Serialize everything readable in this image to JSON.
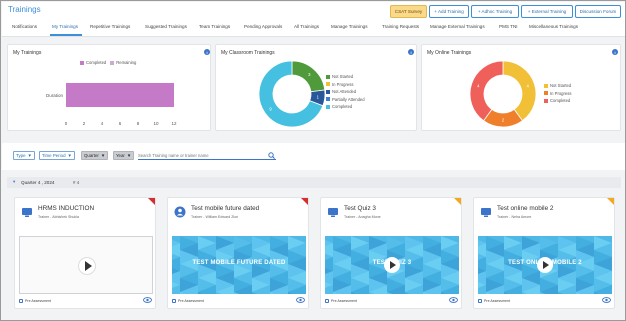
{
  "header": {
    "title": "Trainings",
    "buttons": [
      "CSAT Survey",
      "+ Add Training",
      "+ Adhoc Training",
      "+ External Training",
      "Discussion Forum"
    ]
  },
  "tabs": [
    "Notifications",
    "My Trainings",
    "Repetitive Trainings",
    "Suggested Trainings",
    "Team Trainings",
    "Pending Approvals",
    "All Trainings",
    "Manage Trainings",
    "Training Requests",
    "Manage External Trainings",
    "PMS TNI",
    "Miscellaneous Trainings"
  ],
  "active_tab": "My Trainings",
  "my_trainings": {
    "title": "My Trainings",
    "legend": [
      "Completed",
      "Remaining"
    ],
    "category": "Duration",
    "ticks": [
      "0",
      "2",
      "4",
      "6",
      "8",
      "10",
      "12"
    ],
    "chart_data": {
      "type": "bar",
      "orientation": "horizontal",
      "categories": [
        "Duration"
      ],
      "series": [
        {
          "name": "Completed",
          "values": [
            12
          ]
        },
        {
          "name": "Remaining",
          "values": [
            0
          ]
        }
      ],
      "xlim": [
        0,
        12
      ],
      "colors": {
        "Completed": "#c57ac7",
        "Remaining": "#d0a8d6"
      }
    }
  },
  "classroom": {
    "title": "My Classroom Trainings",
    "legend": [
      {
        "label": "Not Started",
        "color": "#4f9a3a"
      },
      {
        "label": "In Progress",
        "color": "#f2c037"
      },
      {
        "label": "Not Attended",
        "color": "#28579a"
      },
      {
        "label": "Partially Attended",
        "color": "#3a7fd5"
      },
      {
        "label": "Completed",
        "color": "#45c0e0"
      }
    ],
    "chart_data": {
      "type": "pie",
      "labels": [
        "Not Started",
        "In Progress",
        "Not Attended",
        "Partially Attended",
        "Completed"
      ],
      "values": [
        3,
        0,
        1,
        0,
        9
      ]
    }
  },
  "online": {
    "title": "My Online Trainings",
    "legend": [
      {
        "label": "Not Started",
        "color": "#f2c037"
      },
      {
        "label": "In Progress",
        "color": "#f07f2c"
      },
      {
        "label": "Completed",
        "color": "#f0605a"
      }
    ],
    "chart_data": {
      "type": "pie",
      "labels": [
        "Not Started",
        "In Progress",
        "Completed"
      ],
      "values": [
        4,
        2,
        4
      ]
    }
  },
  "filters": {
    "type": "Type",
    "time_period": "Time Period",
    "quarter": "Quarter",
    "year": "Year",
    "search_placeholder": "Search Training name or trainer name"
  },
  "quarter_group": {
    "label": "Quarter 4 , 2024",
    "count": "4"
  },
  "courses": [
    {
      "title": "HRMS INDUCTION",
      "trainer": "Trainer - Abhishek Shukla",
      "footer": "Pre Assessment",
      "thumb": "",
      "corner": "red"
    },
    {
      "title": "Test mobile future dated",
      "trainer": "Trainer - William Edward Zion",
      "footer": "Pre Assessment",
      "thumb": "TEST MOBILE FUTURE DATED",
      "corner": "red"
    },
    {
      "title": "Test Quiz 3",
      "trainer": "Trainer - Anagha Mone",
      "footer": "Pre Assessment",
      "thumb": "TEST QUIZ 3",
      "corner": "orange"
    },
    {
      "title": "Test online mobile 2",
      "trainer": "Trainer - Neha Amore",
      "footer": "Pre Assessment",
      "thumb": "TEST ONLINE MOBILE 2",
      "corner": "orange"
    }
  ],
  "icons": {
    "info": "info-icon",
    "filter": "funnel-icon",
    "search": "search-icon",
    "play": "play-icon",
    "eye": "eye-icon",
    "user": "user-icon",
    "collapse": "caret-down-icon"
  }
}
